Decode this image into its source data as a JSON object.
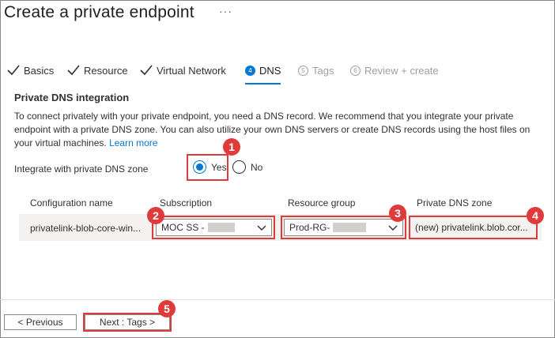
{
  "header": {
    "title": "Create a private endpoint",
    "more_label": "···"
  },
  "tabs": [
    {
      "label": "Basics",
      "state": "completed",
      "icon": "check-icon"
    },
    {
      "label": "Resource",
      "state": "completed",
      "icon": "check-icon"
    },
    {
      "label": "Virtual Network",
      "state": "completed",
      "icon": "check-icon"
    },
    {
      "label": "DNS",
      "number": "4",
      "state": "active"
    },
    {
      "label": "Tags",
      "number": "5",
      "state": "disabled"
    },
    {
      "label": "Review + create",
      "number": "6",
      "state": "disabled"
    }
  ],
  "section": {
    "title": "Private DNS integration",
    "description": "To connect privately with your private endpoint, you need a DNS record. We recommend that you integrate your private endpoint with a private DNS zone. You can also utilize your own DNS servers or create DNS records using the host files on your virtual machines.",
    "learn_more": "Learn more"
  },
  "integrate": {
    "label": "Integrate with private DNS zone",
    "options": [
      "Yes",
      "No"
    ],
    "selected": "Yes"
  },
  "table": {
    "headers": [
      "Configuration name",
      "Subscription",
      "Resource group",
      "Private DNS zone"
    ],
    "row": {
      "configuration_name": "privatelink-blob-core-win...",
      "subscription": "MOC SS -",
      "resource_group": "Prod-RG-",
      "private_dns_zone": "(new) privatelink.blob.cor..."
    }
  },
  "callouts": [
    "1",
    "2",
    "3",
    "4",
    "5"
  ],
  "footer": {
    "previous_label": "< Previous",
    "next_label": "Next : Tags >"
  },
  "colors": {
    "accent": "#0078d4",
    "callout": "#e03b3b",
    "row_background": "#f3f2f1"
  }
}
